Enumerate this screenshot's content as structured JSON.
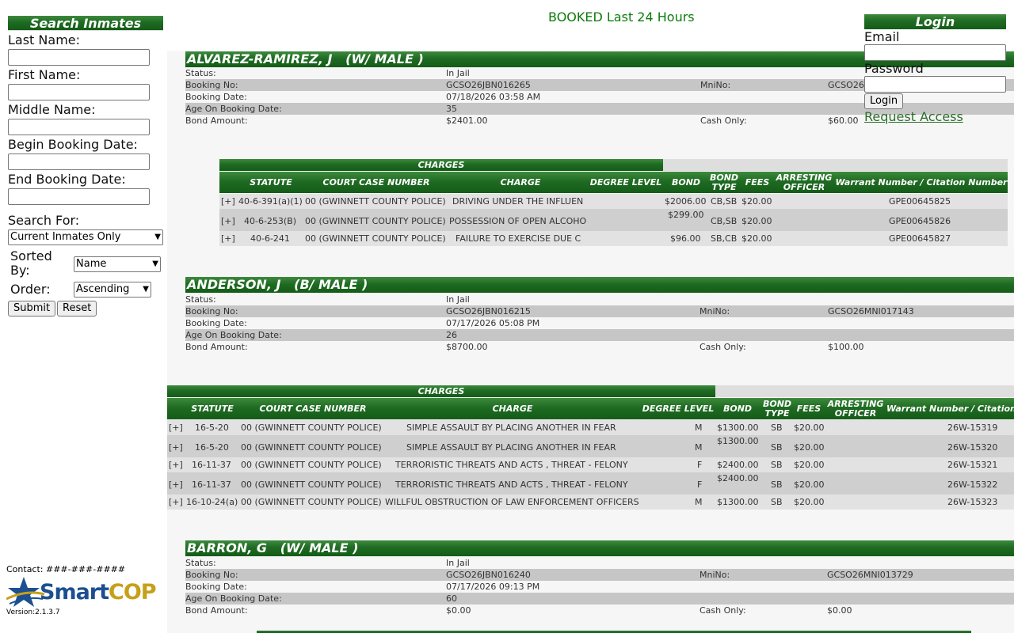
{
  "search": {
    "title": "Search Inmates",
    "last_name_label": "Last Name:",
    "first_name_label": "First Name:",
    "middle_name_label": "Middle Name:",
    "begin_date_label": "Begin Booking Date:",
    "end_date_label": "End Booking Date:",
    "search_for_label": "Search For:",
    "search_for_value": "Current Inmates Only",
    "sorted_by_label": "Sorted By:",
    "sorted_by_value": "Name",
    "order_label": "Order:",
    "order_value": "Ascending",
    "submit_label": "Submit",
    "reset_label": "Reset"
  },
  "footer": {
    "contact": "Contact: ###-###-####",
    "logo_smart": "Smart",
    "logo_cop": "COP",
    "version": "Version:2.1.3.7"
  },
  "page_title": "BOOKED Last 24 Hours",
  "login": {
    "title": "Login",
    "email_label": "Email",
    "password_label": "Password",
    "login_button": "Login",
    "request_access": "Request Access"
  },
  "labels": {
    "status": "Status:",
    "booking_no": "Booking No:",
    "booking_date": "Booking Date:",
    "age": "Age On Booking Date:",
    "bond_amount": "Bond Amount:",
    "mni_no": "MniNo:",
    "cash_only": "Cash Only:",
    "charges": "CHARGES",
    "col_statute": "STATUTE",
    "col_case": "COURT CASE NUMBER",
    "col_charge": "CHARGE",
    "col_degree": "DEGREE LEVEL",
    "col_bond": "BOND",
    "col_bond_type": "BOND TYPE",
    "col_fees": "FEES",
    "col_officer": "ARRESTING OFFICER",
    "col_warrant": "Warrant Number / Citation Number",
    "col_warrant_short": "Warrant Number / Citation"
  },
  "inmates": [
    {
      "name": "ALVAREZ-RAMIREZ, J   (W/ MALE )",
      "status": "In Jail",
      "booking_no": "GCSO26JBN016265",
      "mni_no": "GCSO26",
      "booking_date": "07/18/2026 03:58 AM",
      "age": "35",
      "bond_amount": "$2401.00",
      "cash_only": "$60.00",
      "charges": [
        {
          "expand": "[+]",
          "statute": "40-6-391(a)(1)",
          "case": "00 (GWINNETT COUNTY POLICE)",
          "charge": "DRIVING UNDER THE INFLUEN",
          "degree": "",
          "bond": "$2006.00",
          "bond_type": "CB,SB",
          "fees": "$20.00",
          "officer": "",
          "warrant": "GPE00645825"
        },
        {
          "expand": "[+]",
          "statute": "40-6-253(B)",
          "case": "00 (GWINNETT COUNTY POLICE)",
          "charge": "POSSESSION OF OPEN ALCOHO",
          "degree": "",
          "bond": "$299.00",
          "bond_type": "CB,SB",
          "fees": "$20.00",
          "officer": "",
          "warrant": "GPE00645826"
        },
        {
          "expand": "[+]",
          "statute": "40-6-241",
          "case": "00 (GWINNETT COUNTY POLICE)",
          "charge": "FAILURE TO EXERCISE DUE C",
          "degree": "",
          "bond": "$96.00",
          "bond_type": "SB,CB",
          "fees": "$20.00",
          "officer": "",
          "warrant": "GPE00645827"
        }
      ]
    },
    {
      "name": "ANDERSON, J   (B/ MALE )",
      "status": "In Jail",
      "booking_no": "GCSO26JBN016215",
      "mni_no": "GCSO26MNI017143",
      "booking_date": "07/17/2026 05:08 PM",
      "age": "26",
      "bond_amount": "$8700.00",
      "cash_only": "$100.00",
      "charges": [
        {
          "expand": "[+]",
          "statute": "16-5-20",
          "case": "00 (GWINNETT COUNTY POLICE)",
          "charge": "SIMPLE ASSAULT BY PLACING ANOTHER IN FEAR",
          "degree": "M",
          "bond": "$1300.00",
          "bond_type": "SB",
          "fees": "$20.00",
          "officer": "",
          "warrant": "26W-15319"
        },
        {
          "expand": "[+]",
          "statute": "16-5-20",
          "case": "00 (GWINNETT COUNTY POLICE)",
          "charge": "SIMPLE ASSAULT BY PLACING ANOTHER IN FEAR",
          "degree": "M",
          "bond": "$1300.00",
          "bond_type": "SB",
          "fees": "$20.00",
          "officer": "",
          "warrant": "26W-15320"
        },
        {
          "expand": "[+]",
          "statute": "16-11-37",
          "case": "00 (GWINNETT COUNTY POLICE)",
          "charge": "TERRORISTIC THREATS AND ACTS , THREAT - FELONY",
          "degree": "F",
          "bond": "$2400.00",
          "bond_type": "SB",
          "fees": "$20.00",
          "officer": "",
          "warrant": "26W-15321"
        },
        {
          "expand": "[+]",
          "statute": "16-11-37",
          "case": "00 (GWINNETT COUNTY POLICE)",
          "charge": "TERRORISTIC THREATS AND ACTS , THREAT - FELONY",
          "degree": "F",
          "bond": "$2400.00",
          "bond_type": "SB",
          "fees": "$20.00",
          "officer": "",
          "warrant": "26W-15322"
        },
        {
          "expand": "[+]",
          "statute": "16-10-24(a)",
          "case": "00 (GWINNETT COUNTY POLICE)",
          "charge": "WILLFUL OBSTRUCTION OF LAW ENFORCEMENT OFFICERS",
          "degree": "M",
          "bond": "$1300.00",
          "bond_type": "SB",
          "fees": "$20.00",
          "officer": "",
          "warrant": "26W-15323"
        }
      ]
    },
    {
      "name": "BARRON, G   (W/ MALE )",
      "status": "In Jail",
      "booking_no": "GCSO26JBN016240",
      "mni_no": "GCSO26MNI013729",
      "booking_date": "07/17/2026 09:13 PM",
      "age": "60",
      "bond_amount": "$0.00",
      "cash_only": "$0.00",
      "charges": []
    }
  ]
}
